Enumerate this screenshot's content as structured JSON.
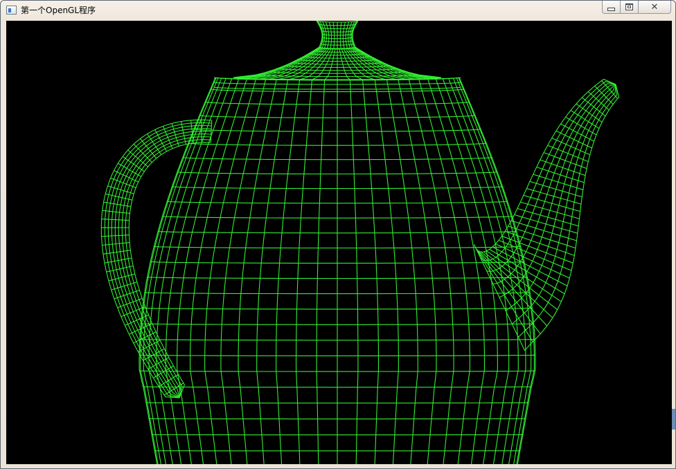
{
  "window": {
    "title": "第一个OpenGL程序",
    "controls": {
      "minimize_icon": "minimize-icon",
      "maximize_icon": "maximize-icon",
      "close_icon": "close-icon",
      "close_glyph": "✕"
    }
  },
  "viewport": {
    "background_color": "#000000",
    "wire_color": "#33ee33"
  }
}
